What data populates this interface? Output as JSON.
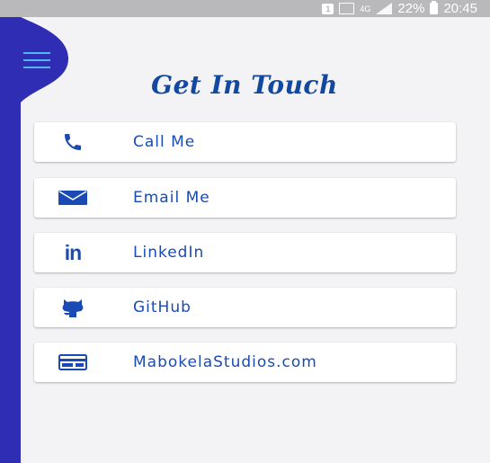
{
  "status_bar": {
    "notification_badge": "1",
    "network_type": "4G",
    "battery_percent": "22%",
    "time": "20:45",
    "icons": [
      "notification-icon",
      "cast-icon",
      "network-type-icon",
      "signal-icon",
      "battery-icon"
    ]
  },
  "drawer": {
    "menu_icon": "hamburger-menu-icon",
    "color": "#2e2db3",
    "accent": "#4fb6ff"
  },
  "header": {
    "title": "Get In Touch",
    "color": "#1248a0"
  },
  "contacts": [
    {
      "label": "Call Me",
      "icon": "phone-icon"
    },
    {
      "label": "Email Me",
      "icon": "email-icon"
    },
    {
      "label": "LinkedIn",
      "icon": "linkedin-icon",
      "icon_text": "in"
    },
    {
      "label": "GitHub",
      "icon": "github-icon"
    },
    {
      "label": "MabokelaStudios.com",
      "icon": "website-icon"
    }
  ],
  "colors": {
    "accent": "#1a4bb4",
    "background": "#f3f3f5",
    "card": "#ffffff"
  }
}
